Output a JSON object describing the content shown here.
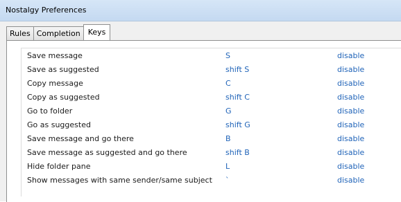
{
  "window": {
    "title": "Nostalgy Preferences"
  },
  "tabs": [
    {
      "label": "Rules",
      "active": false
    },
    {
      "label": "Completion",
      "active": false
    },
    {
      "label": "Keys",
      "active": true
    }
  ],
  "keys": [
    {
      "action": "Save message",
      "key": "S",
      "disable": "disable"
    },
    {
      "action": "Save as suggested",
      "key": "shift S",
      "disable": "disable"
    },
    {
      "action": "Copy message",
      "key": "C",
      "disable": "disable"
    },
    {
      "action": "Copy as suggested",
      "key": "shift C",
      "disable": "disable"
    },
    {
      "action": "Go to folder",
      "key": "G",
      "disable": "disable"
    },
    {
      "action": "Go as suggested",
      "key": "shift G",
      "disable": "disable"
    },
    {
      "action": "Save message and go there",
      "key": "B",
      "disable": "disable"
    },
    {
      "action": "Save message as suggested and go there",
      "key": "shift B",
      "disable": "disable"
    },
    {
      "action": "Hide folder pane",
      "key": "L",
      "disable": "disable"
    },
    {
      "action": "Show messages with same sender/same subject",
      "key": "`",
      "disable": "disable"
    }
  ],
  "colors": {
    "link": "#1f63b8",
    "titlebar": "#c4d9f1"
  }
}
